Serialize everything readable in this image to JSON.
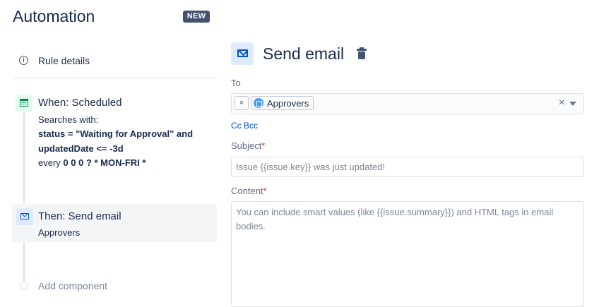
{
  "app": {
    "title": "Automation",
    "badge": "NEW"
  },
  "sidebar": {
    "rule_details": {
      "label": "Rule details",
      "icon": "info-icon"
    },
    "trigger": {
      "icon": "calendar-icon",
      "title": "When: Scheduled",
      "line1": "Searches with:",
      "jql_line1": "status = \"Waiting for Approval\" and",
      "jql_line2": "updatedDate <= -3d",
      "schedule_prefix": "every",
      "schedule_cron": "0 0 0 ? * MON-FRI *"
    },
    "action": {
      "icon": "email-icon",
      "title": "Then: Send email",
      "subtitle": "Approvers"
    },
    "add_component": "Add component"
  },
  "editor": {
    "icon": "email-icon",
    "title": "Send email",
    "delete_icon": "trash-icon",
    "to": {
      "label": "To",
      "chip_remove": "×",
      "recipient": "Approvers",
      "clear": "×"
    },
    "cc_bcc": "Cc Bcc",
    "subject": {
      "label": "Subject",
      "required_mark": "*",
      "placeholder": "Issue {{issue.key}} was just updated!"
    },
    "content": {
      "label": "Content",
      "required_mark": "*",
      "placeholder": "You can include smart values (like {{issue.summary}}) and HTML tags in email bodies."
    }
  },
  "colors": {
    "text": "#172b4d",
    "accent": "#0052cc",
    "required": "#de350b",
    "trigger_bg": "#e3fcef",
    "trigger_fg": "#00875a",
    "action_bg": "#deebff",
    "badge_bg": "#42526e"
  }
}
